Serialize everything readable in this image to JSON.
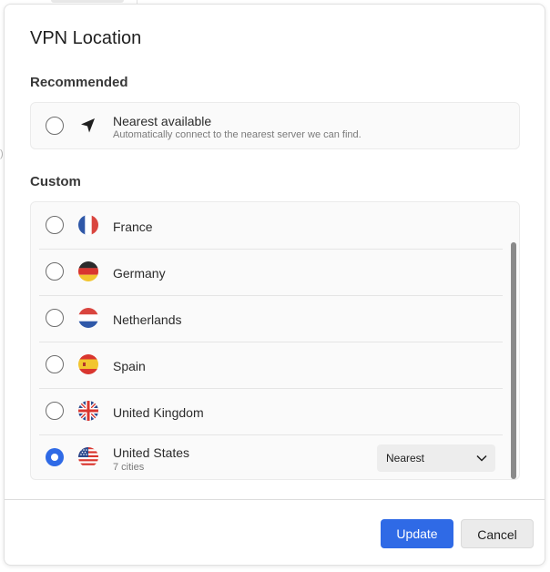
{
  "dialog": {
    "title": "VPN Location",
    "recommended": {
      "heading": "Recommended",
      "option": {
        "label": "Nearest available",
        "description": "Automatically connect to the nearest server we can find.",
        "icon": "navigation-arrow-icon",
        "selected": false
      }
    },
    "custom": {
      "heading": "Custom",
      "locations": [
        {
          "label": "France",
          "flag": "france-flag-icon",
          "selected": false
        },
        {
          "label": "Germany",
          "flag": "germany-flag-icon",
          "selected": false
        },
        {
          "label": "Netherlands",
          "flag": "netherlands-flag-icon",
          "selected": false
        },
        {
          "label": "Spain",
          "flag": "spain-flag-icon",
          "selected": false
        },
        {
          "label": "United Kingdom",
          "flag": "uk-flag-icon",
          "selected": false
        },
        {
          "label": "United States",
          "sublabel": "7 cities",
          "flag": "us-flag-icon",
          "selected": true,
          "city_select": {
            "value": "Nearest"
          }
        }
      ]
    },
    "buttons": {
      "update": "Update",
      "cancel": "Cancel"
    },
    "colors": {
      "accent": "#2f6ae6",
      "secondary_button": "#ebebeb"
    }
  }
}
